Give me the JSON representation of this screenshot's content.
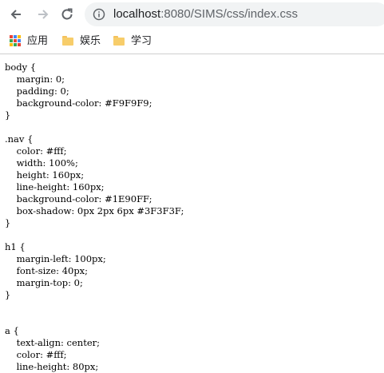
{
  "browser": {
    "url_host": "localhost",
    "url_rest": ":8080/SIMS/css/index.css",
    "colors": {
      "omnibox": "#f1f3f4",
      "folder": "#f7cd6a"
    }
  },
  "bookmarks": [
    {
      "label": "应用",
      "icon": "apps-grid-icon"
    },
    {
      "label": "娱乐",
      "icon": "folder-icon"
    },
    {
      "label": "学习",
      "icon": "folder-icon"
    }
  ],
  "page": {
    "css_text": "body {\n    margin: 0;\n    padding: 0;\n    background-color: #F9F9F9;\n}\n\n.nav {\n    color: #fff;\n    width: 100%;\n    height: 160px;\n    line-height: 160px;\n    background-color: #1E90FF;\n    box-shadow: 0px 2px 6px #3F3F3F;\n}\n\nh1 {\n    margin-left: 100px;\n    font-size: 40px;\n    margin-top: 0;\n}\n\n\na {\n    text-align: center;\n    color: #fff;\n    line-height: 80px;"
  }
}
